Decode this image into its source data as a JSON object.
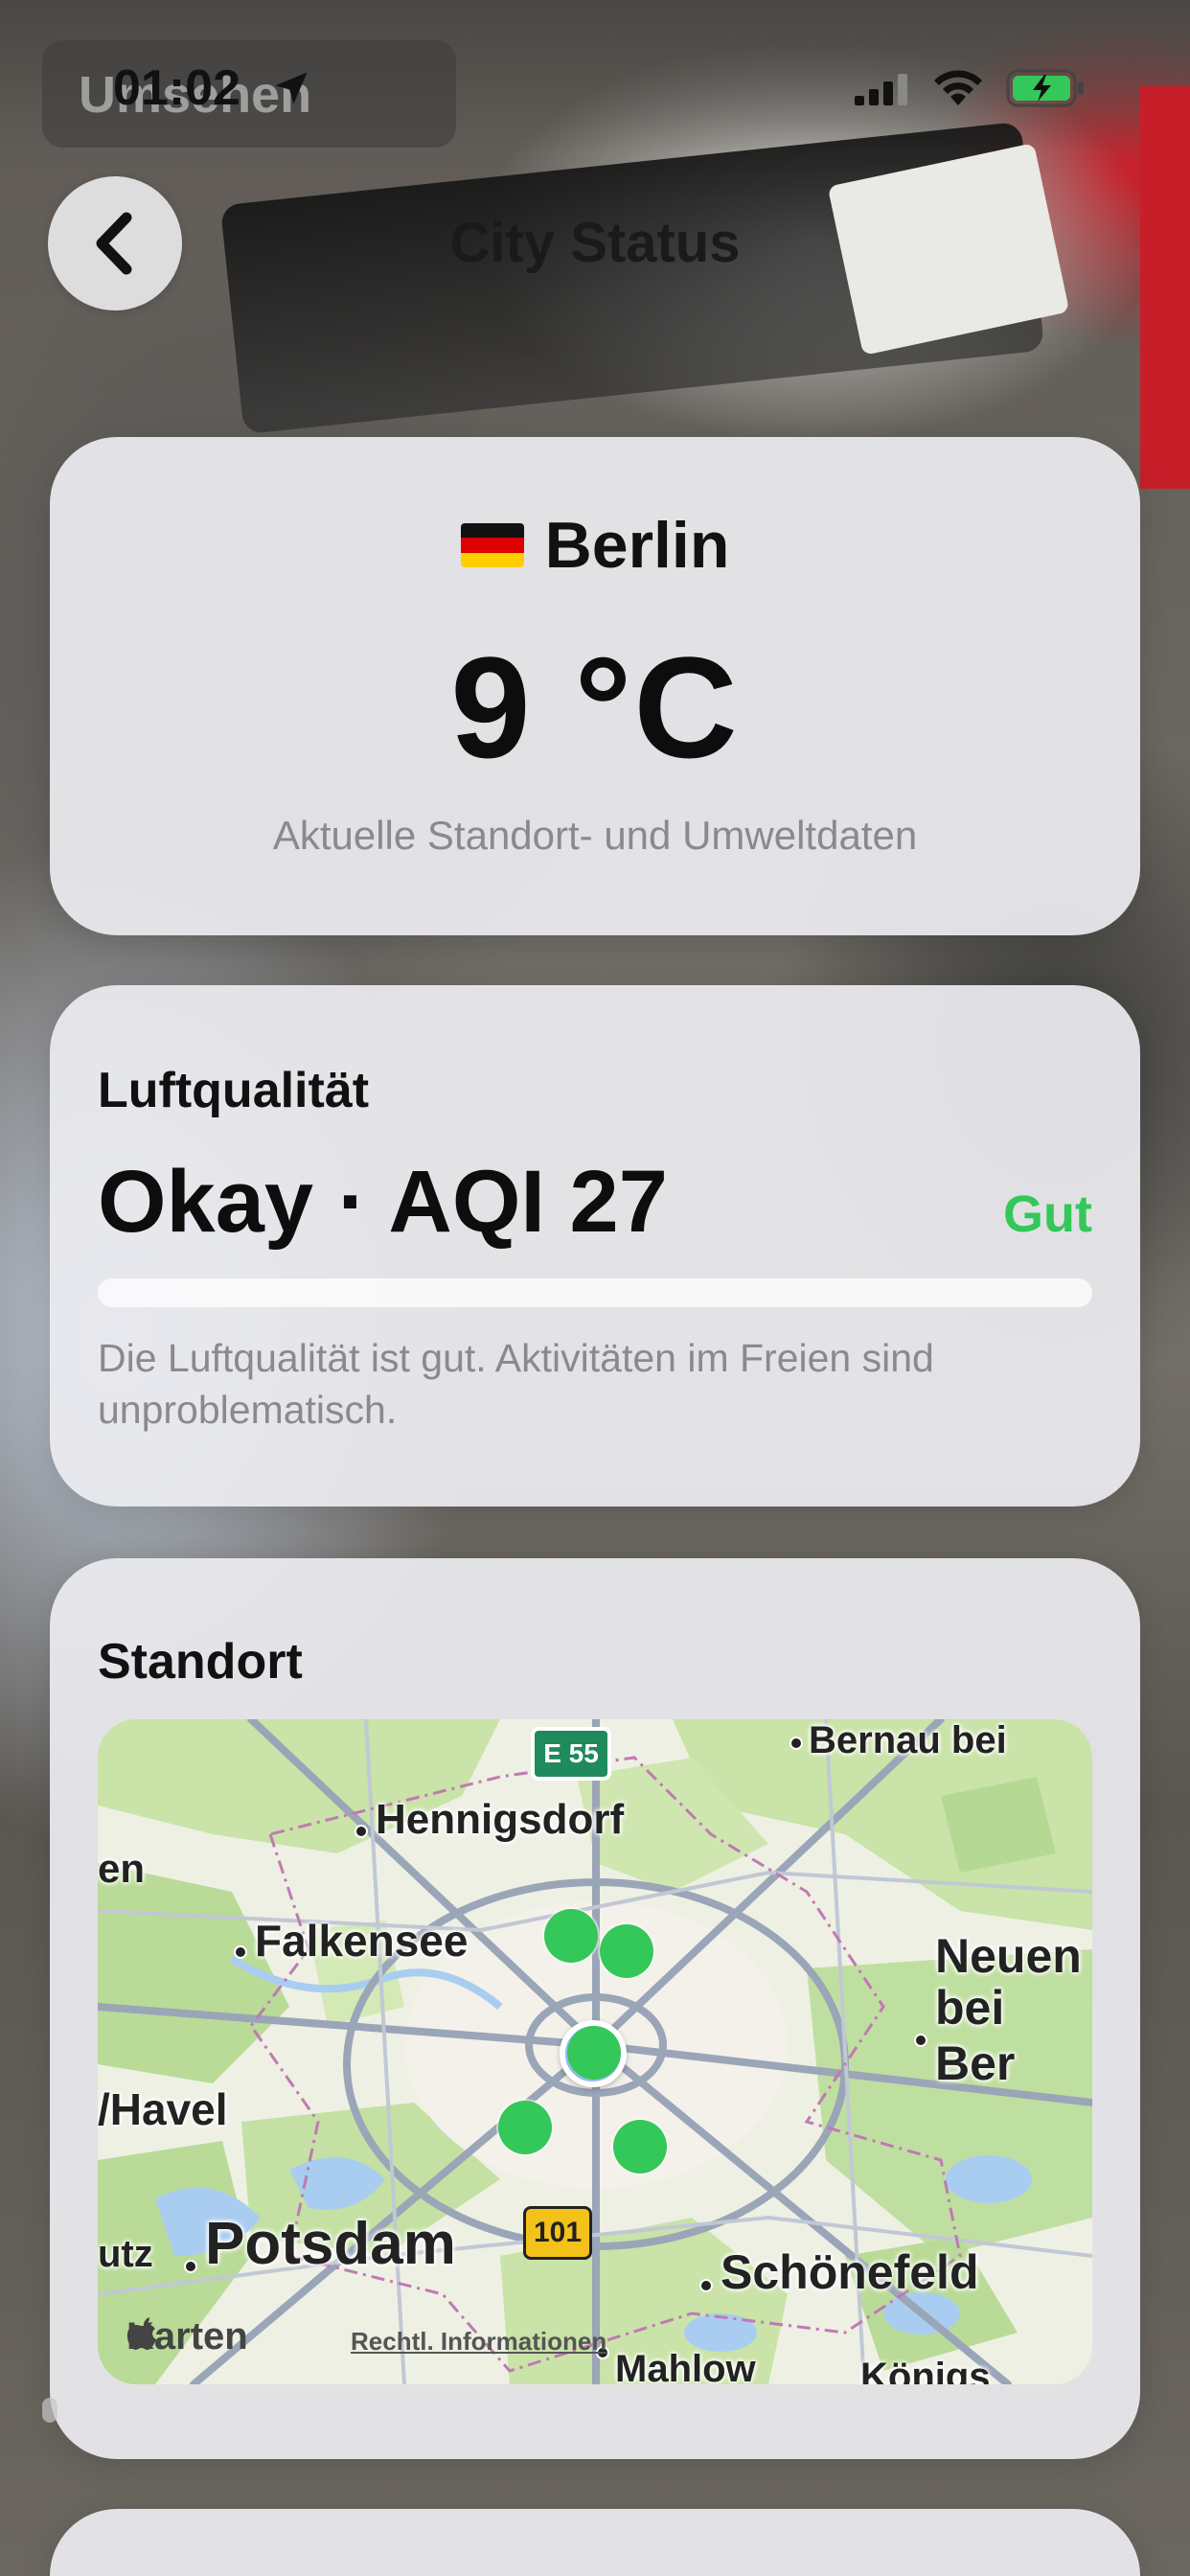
{
  "status_bar": {
    "time": "01:02",
    "overlay_label": "Umsehen",
    "icons": [
      "location-arrow-icon",
      "cellular-signal-icon",
      "wifi-icon",
      "battery-charging-icon"
    ]
  },
  "nav": {
    "title": "City Status",
    "back_icon": "chevron-left-icon"
  },
  "city_card": {
    "flag_icon": "germany-flag-icon",
    "city": "Berlin",
    "temperature": "9 °C",
    "subtitle": "Aktuelle Standort- und Umweltdaten"
  },
  "air_card": {
    "label": "Luftqualität",
    "headline": "Okay · AQI 27",
    "rating": "Gut",
    "rating_color": "#34c759",
    "aqi_value": 27,
    "description": "Die Luftqualität ist gut. Aktivitäten im Freien sind unproblematisch."
  },
  "location_card": {
    "label": "Standort",
    "map": {
      "places": {
        "bernau": "Bernau bei",
        "hennigsdorf": "Hennigsdorf",
        "falkensee": "Falkensee",
        "neuenhagen_1": "Neuen",
        "neuenhagen_2": "bei Ber",
        "havel": "/Havel",
        "potsdam": "Potsdam",
        "utz": "utz",
        "schoenefeld": "Schönefeld",
        "mahlow": "Mahlow",
        "koenigs": "Königs",
        "en": "en"
      },
      "road_shields": {
        "e55": "E 55",
        "r101": "101"
      },
      "attribution": "Karten",
      "legal": "Rechtl. Informationen",
      "pin_color": "#34c759",
      "user_location_color": "#2f7ae5"
    }
  },
  "colors": {
    "card_background": "#ececf0",
    "text_primary": "#111111",
    "text_secondary": "#8a8a8e",
    "accent_green": "#34c759"
  }
}
